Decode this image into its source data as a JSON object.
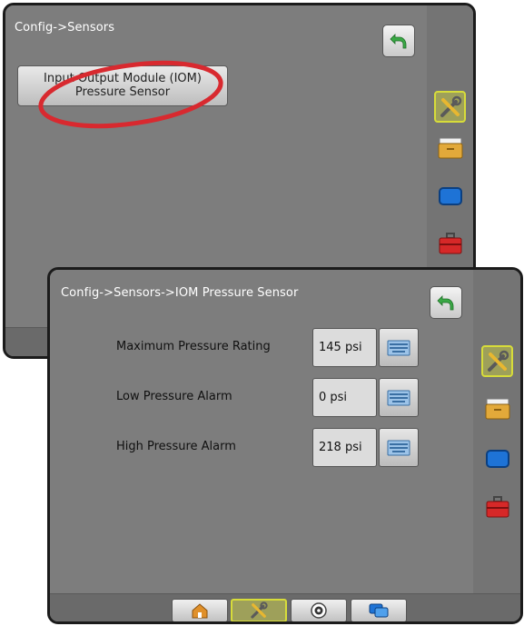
{
  "screen1": {
    "breadcrumb": "Config->Sensors",
    "option_button_line1": "Input Output Module (IOM)",
    "option_button_line2": "Pressure Sensor"
  },
  "screen2": {
    "breadcrumb": "Config->Sensors->IOM Pressure Sensor",
    "rows": [
      {
        "label": "Maximum Pressure Rating",
        "value": "145 psi"
      },
      {
        "label": "Low Pressure Alarm",
        "value": "0 psi"
      },
      {
        "label": "High Pressure Alarm",
        "value": "218 psi"
      }
    ]
  },
  "sidebar_icons": [
    "tools-icon",
    "folder-icon",
    "display-icon",
    "toolbox-icon"
  ],
  "bottom_tabs": [
    "home-icon",
    "tools-icon",
    "camera-icon",
    "data-transfer-icon"
  ],
  "colors": {
    "highlight_circle": "#d8292f",
    "selected_border": "#d7dc3a",
    "back_arrow": "#3aa845",
    "folder": "#e2a93a",
    "display": "#1e73d6",
    "toolbox": "#d62828"
  }
}
